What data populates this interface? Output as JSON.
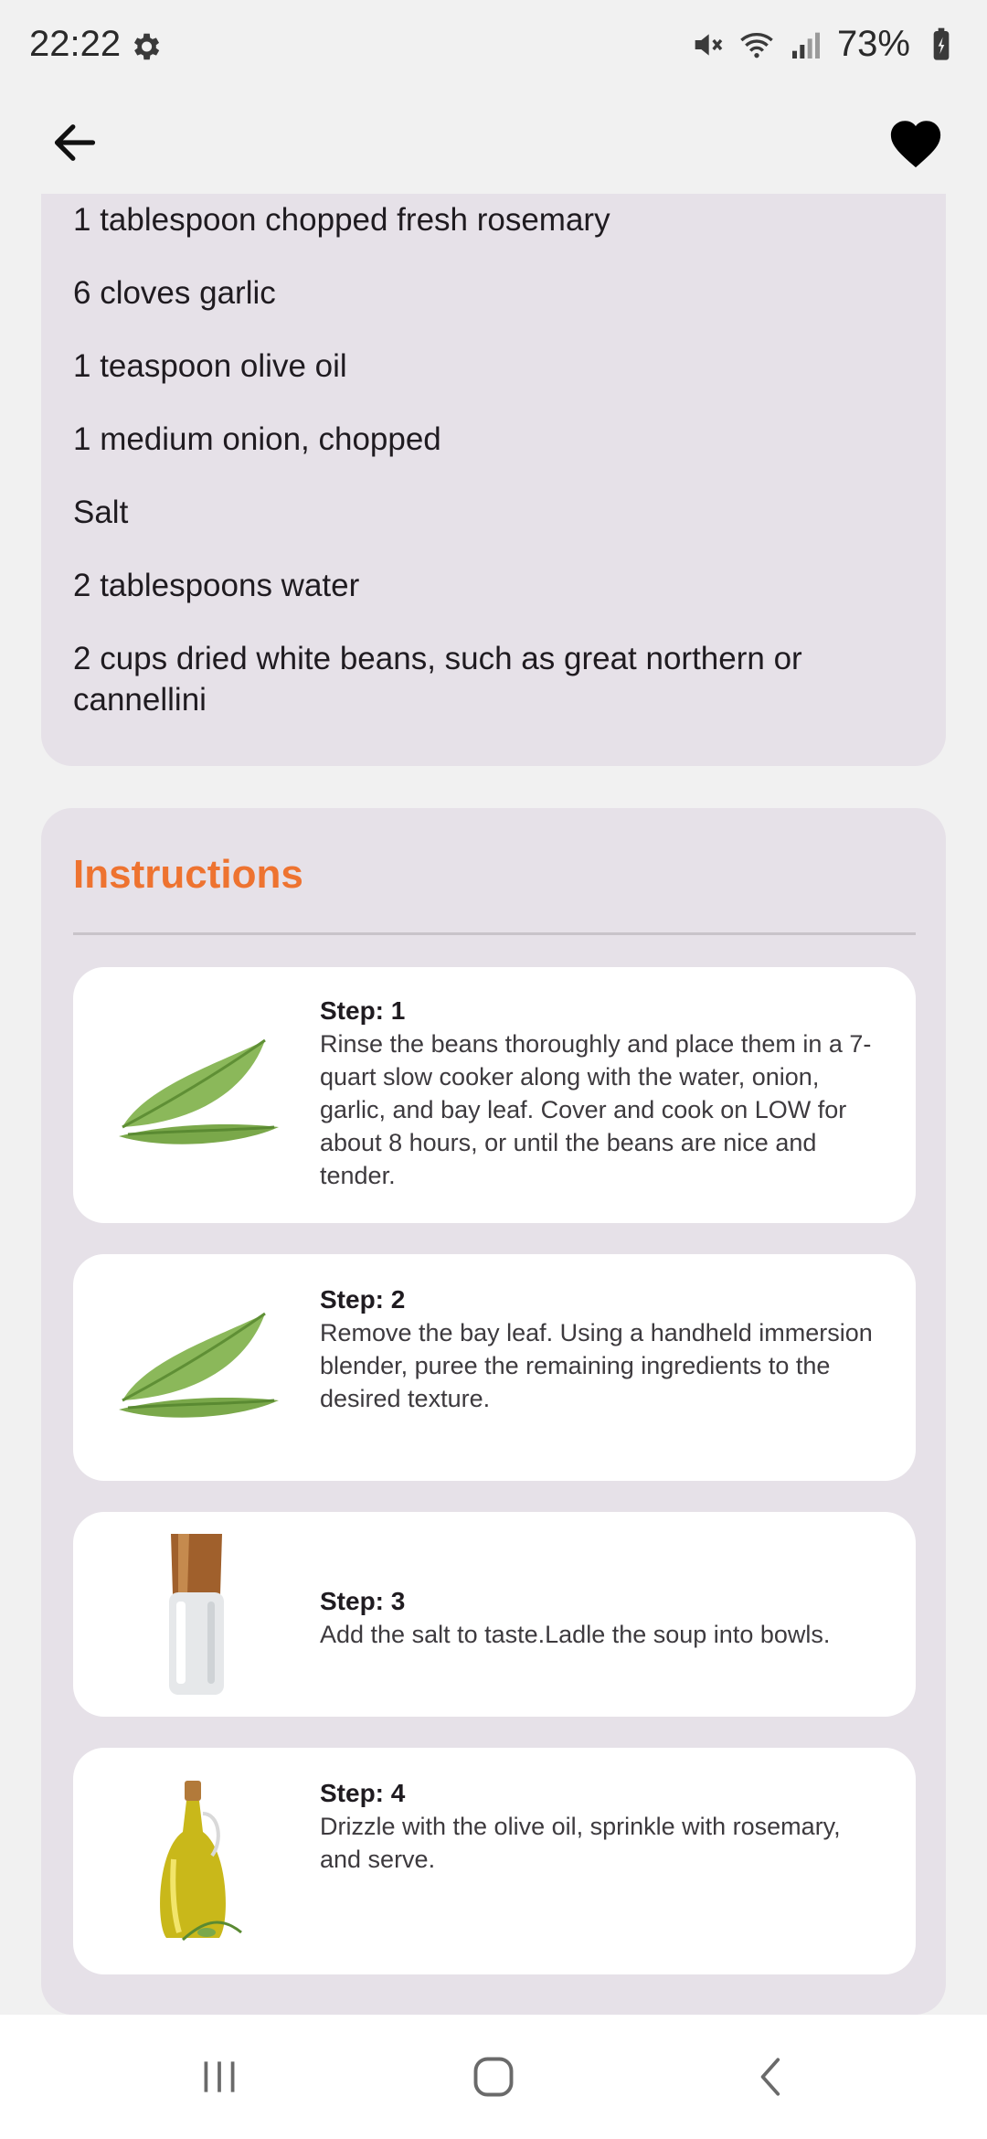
{
  "status_bar": {
    "time": "22:22",
    "battery": "73%",
    "icons": [
      "gear-icon",
      "mute-icon",
      "wifi-icon",
      "signal-icon",
      "battery-icon"
    ]
  },
  "app_bar": {
    "icons": [
      "back-arrow-icon",
      "heart-icon"
    ]
  },
  "ingredients": {
    "items": [
      "1 tablespoon chopped fresh rosemary",
      "6 cloves garlic",
      "1 teaspoon olive oil",
      "1 medium onion, chopped",
      "Salt",
      "2 tablespoons water",
      "2 cups dried white beans, such as great northern or cannellini"
    ]
  },
  "instructions": {
    "title": "Instructions",
    "steps": [
      {
        "label": "Step: 1",
        "text": "Rinse the beans thoroughly and place them in a 7-quart slow cooker along with the water, onion, garlic, and bay leaf. Cover and cook on LOW for about 8 hours, or until the beans are nice and tender.",
        "image": "bay-leaf-image"
      },
      {
        "label": "Step: 2",
        "text": "Remove the bay leaf. Using a handheld immersion blender, puree the remaining ingredients to the desired texture.",
        "image": "bay-leaf-image"
      },
      {
        "label": "Step: 3",
        "text": "Add the salt to taste.Ladle the soup into bowls.",
        "image": "salt-shaker-image"
      },
      {
        "label": "Step: 4",
        "text": "Drizzle with the olive oil, sprinkle with rosemary, and serve.",
        "image": "olive-oil-bottle-image"
      }
    ]
  },
  "colors": {
    "accent": "#ee7330",
    "card_bg": "#e6e1e8",
    "page_bg": "#f1f1f1"
  },
  "nav_bar": {
    "icons": [
      "recent-apps-icon",
      "home-icon",
      "back-icon"
    ]
  }
}
